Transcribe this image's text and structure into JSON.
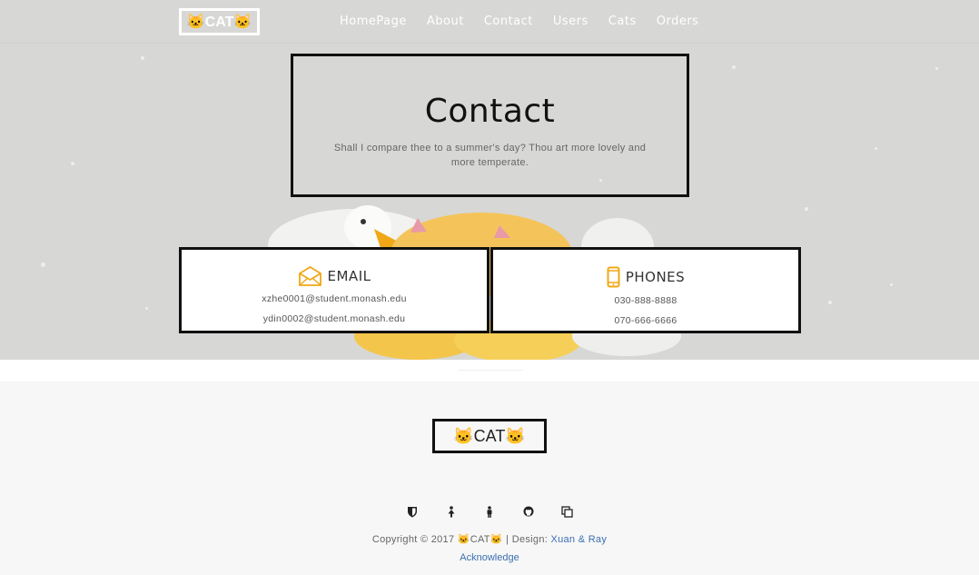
{
  "nav": {
    "brand": "🐱CAT🐱",
    "links": [
      "HomePage",
      "About",
      "Contact",
      "Users",
      "Cats",
      "Orders"
    ]
  },
  "hero": {
    "title": "Contact",
    "subtitle": "Shall I compare thee to a summer's day? Thou art more lovely and more temperate."
  },
  "email_card": {
    "icon": "envelope-icon",
    "heading": "EMAIL",
    "lines": [
      "xzhe0001@student.monash.edu",
      "ydin0002@student.monash.edu"
    ]
  },
  "phone_card": {
    "icon": "mobile-phone-icon",
    "heading": "PHONES",
    "lines": [
      "030-888-8888",
      "070-666-6666"
    ]
  },
  "footer": {
    "logo": "🐱CAT🐱",
    "icons": [
      "shield-icon",
      "female-icon",
      "male-icon",
      "github-icon",
      "copy-icon"
    ],
    "copyright_prefix": "Copyright © 2017 🐱CAT🐱 | Design: ",
    "designers": "Xuan & Ray",
    "acknowledge": "Acknowledge"
  },
  "colors": {
    "accent": "#f0a817",
    "link": "#3a6fb0",
    "border": "#111111",
    "hero_bg": "#d7d7d5"
  }
}
